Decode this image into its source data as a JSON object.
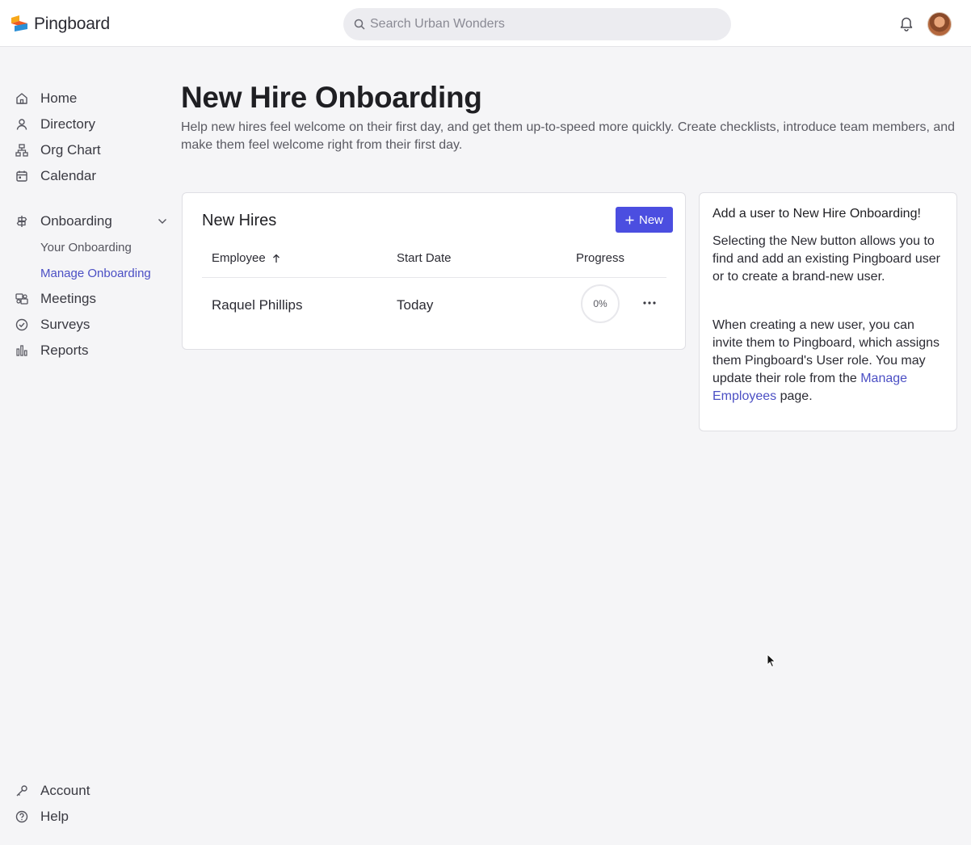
{
  "app": {
    "name": "Pingboard"
  },
  "search": {
    "placeholder": "Search Urban Wonders"
  },
  "sidebar": {
    "items": [
      {
        "label": "Home",
        "icon": "home-icon"
      },
      {
        "label": "Directory",
        "icon": "person-icon"
      },
      {
        "label": "Org Chart",
        "icon": "org-chart-icon"
      },
      {
        "label": "Calendar",
        "icon": "calendar-icon"
      },
      {
        "label": "Onboarding",
        "icon": "signpost-icon"
      },
      {
        "label": "Meetings",
        "icon": "meetings-icon"
      },
      {
        "label": "Surveys",
        "icon": "check-circle-icon"
      },
      {
        "label": "Reports",
        "icon": "bar-chart-icon"
      }
    ],
    "onboarding_sub": [
      {
        "label": "Your Onboarding"
      },
      {
        "label": "Manage Onboarding",
        "active": true
      }
    ],
    "bottom": [
      {
        "label": "Account",
        "icon": "key-icon"
      },
      {
        "label": "Help",
        "icon": "question-icon"
      }
    ]
  },
  "page": {
    "title": "New Hire Onboarding",
    "description": "Help new hires feel welcome on their first day, and get them up-to-speed more quickly. Create checklists, introduce team members, and make them feel welcome right from their first day."
  },
  "new_hires": {
    "title": "New Hires",
    "new_button": "New",
    "columns": [
      "Employee",
      "Start Date",
      "Progress"
    ],
    "rows": [
      {
        "employee": "Raquel Phillips",
        "start_date": "Today",
        "progress": "0%"
      }
    ]
  },
  "info": {
    "title": "Add a user to New Hire Onboarding!",
    "p1": "Selecting the New button allows you to find and add an existing Pingboard user or to create a brand-new user.",
    "p2_before": "When creating a new user, you can invite them to Pingboard, which assigns them Pingboard's User role. You may update their role from the ",
    "p2_link": "Manage Employees",
    "p2_after": " page."
  },
  "colors": {
    "accent": "#4b4ee0",
    "link": "#4b4fc4",
    "background": "#f5f5f7"
  }
}
